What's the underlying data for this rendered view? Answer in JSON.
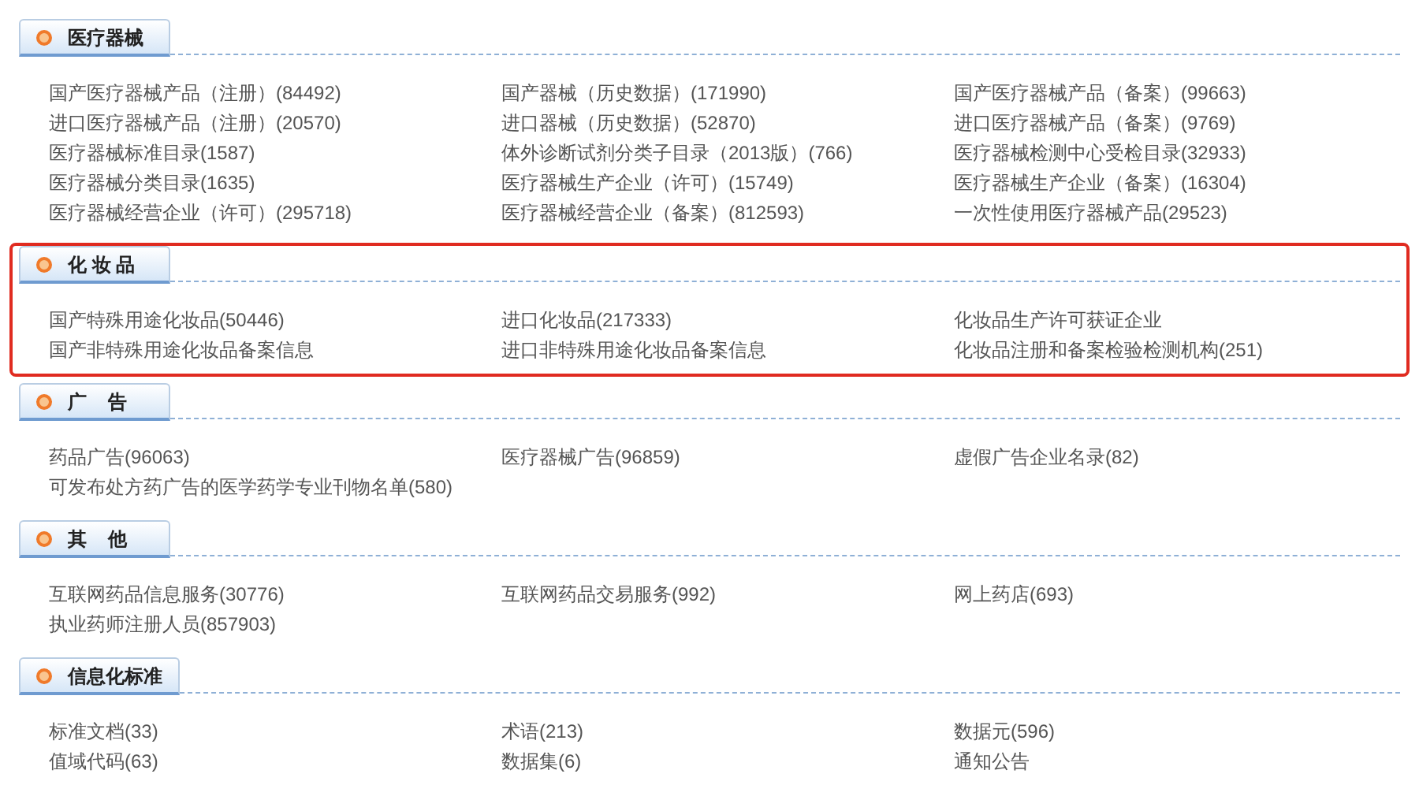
{
  "sections": [
    {
      "title": "医疗器械",
      "highlighted": false,
      "items": [
        "国产医疗器械产品（注册）(84492)",
        "国产器械（历史数据）(171990)",
        "国产医疗器械产品（备案）(99663)",
        "进口医疗器械产品（注册）(20570)",
        "进口器械（历史数据）(52870)",
        "进口医疗器械产品（备案）(9769)",
        "医疗器械标准目录(1587)",
        "体外诊断试剂分类子目录（2013版）(766)",
        "医疗器械检测中心受检目录(32933)",
        "医疗器械分类目录(1635)",
        "医疗器械生产企业（许可）(15749)",
        "医疗器械生产企业（备案）(16304)",
        "医疗器械经营企业（许可）(295718)",
        "医疗器械经营企业（备案）(812593)",
        "一次性使用医疗器械产品(29523)"
      ]
    },
    {
      "title": "化 妆 品",
      "highlighted": true,
      "items": [
        "国产特殊用途化妆品(50446)",
        "进口化妆品(217333)",
        "化妆品生产许可获证企业",
        "国产非特殊用途化妆品备案信息",
        "进口非特殊用途化妆品备案信息",
        "化妆品注册和备案检验检测机构(251)"
      ]
    },
    {
      "title": "广    告",
      "highlighted": false,
      "items": [
        "药品广告(96063)",
        "医疗器械广告(96859)",
        "虚假广告企业名录(82)",
        "可发布处方药广告的医学药学专业刊物名单(580)"
      ]
    },
    {
      "title": "其    他",
      "highlighted": false,
      "items": [
        "互联网药品信息服务(30776)",
        "互联网药品交易服务(992)",
        "网上药店(693)",
        "执业药师注册人员(857903)"
      ]
    },
    {
      "title": "信息化标准",
      "highlighted": false,
      "items": [
        "标准文档(33)",
        "术语(213)",
        "数据元(596)",
        "值域代码(63)",
        "数据集(6)",
        "通知公告"
      ]
    }
  ]
}
